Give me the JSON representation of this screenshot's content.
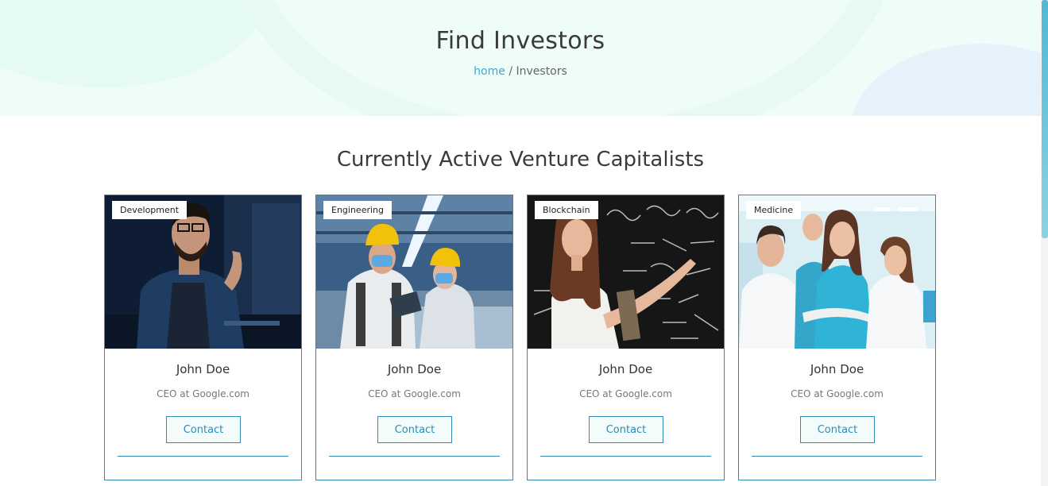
{
  "hero": {
    "title": "Find Investors",
    "breadcrumb": {
      "home": "home",
      "separator": " / ",
      "current": "Investors"
    }
  },
  "section": {
    "title": "Currently Active Venture Capitalists"
  },
  "cards": [
    {
      "tag": "Development",
      "name": "John Doe",
      "role": "CEO at Google.com",
      "button": "Contact",
      "image": "man-at-computer"
    },
    {
      "tag": "Engineering",
      "name": "John Doe",
      "role": "CEO at Google.com",
      "button": "Contact",
      "image": "factory-workers"
    },
    {
      "tag": "Blockchain",
      "name": "John Doe",
      "role": "CEO at Google.com",
      "button": "Contact",
      "image": "woman-at-chalkboard"
    },
    {
      "tag": "Medicine",
      "name": "John Doe",
      "role": "CEO at Google.com",
      "button": "Contact",
      "image": "medical-team"
    }
  ],
  "colors": {
    "accent": "#2f8bb5",
    "link": "#3aa9d4",
    "hero_bg": "#effdf8"
  }
}
